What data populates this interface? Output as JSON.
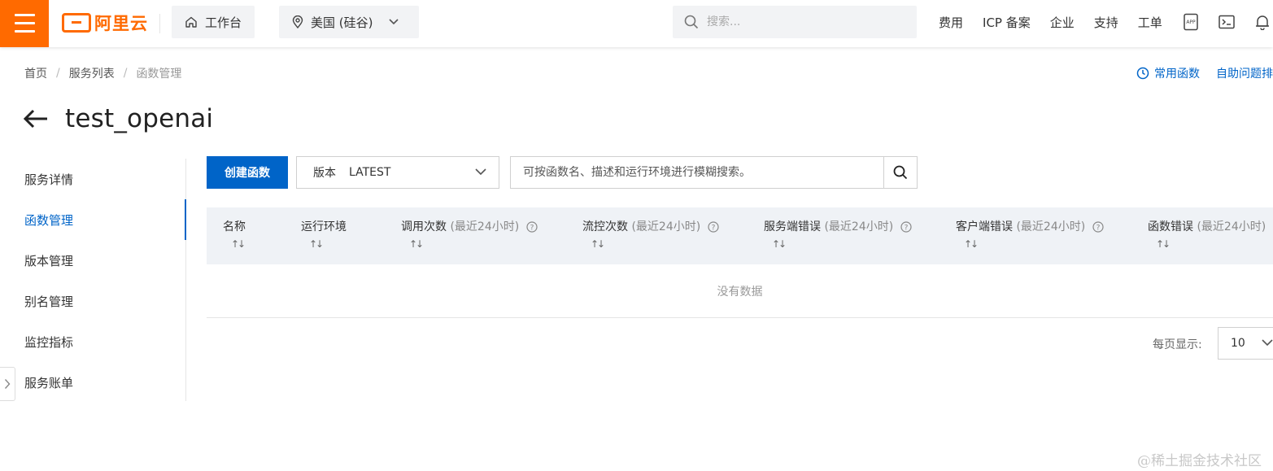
{
  "topbar": {
    "brand": "阿里云",
    "workbench_label": "工作台",
    "region_label": "美国 (硅谷)",
    "search_placeholder": "搜索...",
    "nav": [
      "费用",
      "ICP 备案",
      "企业",
      "支持",
      "工单"
    ],
    "icons": [
      "app-icon",
      "terminal-icon",
      "bell-icon"
    ],
    "accent_color": "#ff6a00"
  },
  "breadcrumb": {
    "items": [
      "首页",
      "服务列表",
      "函数管理"
    ]
  },
  "help_links": {
    "common_functions": "常用函数",
    "self_help": "自助问题排"
  },
  "page": {
    "title": "test_openai",
    "primary_color": "#0064c8"
  },
  "sidenav": {
    "items": [
      "服务详情",
      "函数管理",
      "版本管理",
      "别名管理",
      "监控指标",
      "服务账单"
    ],
    "active_index": 1
  },
  "toolbar": {
    "create_label": "创建函数",
    "version_label": "版本",
    "version_value": "LATEST",
    "search_placeholder": "可按函数名、描述和运行环境进行模糊搜索。"
  },
  "table": {
    "columns": [
      {
        "label": "名称",
        "suffix": "",
        "help": false
      },
      {
        "label": "运行环境",
        "suffix": "",
        "help": false
      },
      {
        "label": "调用次数",
        "suffix": "(最近24小时)",
        "help": true
      },
      {
        "label": "流控次数",
        "suffix": "(最近24小时)",
        "help": true
      },
      {
        "label": "服务端错误",
        "suffix": "(最近24小时)",
        "help": true
      },
      {
        "label": "客户端错误",
        "suffix": "(最近24小时)",
        "help": true
      },
      {
        "label": "函数错误",
        "suffix": "(最近24小时)",
        "help": false
      }
    ],
    "empty_text": "没有数据"
  },
  "pagination": {
    "page_size_label": "每页显示:",
    "page_size": "10"
  },
  "watermark": "@稀土掘金技术社区"
}
